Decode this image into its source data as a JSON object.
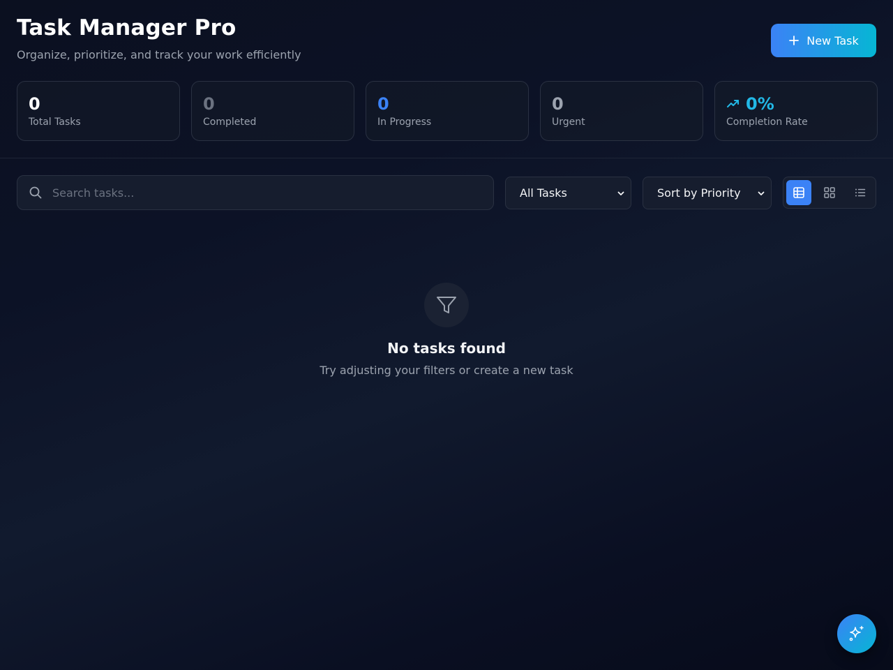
{
  "header": {
    "title": "Task Manager Pro",
    "subtitle": "Organize, prioritize, and track your work efficiently",
    "new_task_label": "New Task"
  },
  "stats": [
    {
      "value": "0",
      "label": "Total Tasks",
      "color": "#ffffff"
    },
    {
      "value": "0",
      "label": "Completed",
      "color": "#6b7280"
    },
    {
      "value": "0",
      "label": "In Progress",
      "color": "#3b82f6"
    },
    {
      "value": "0",
      "label": "Urgent",
      "color": "#9ca3af"
    },
    {
      "value": "0%",
      "label": "Completion Rate",
      "color": "#22b8e6"
    }
  ],
  "toolbar": {
    "search_placeholder": "Search tasks...",
    "filter_selected": "All Tasks",
    "sort_selected": "Sort by Priority",
    "views": [
      "table-view-icon",
      "grid-view-icon",
      "list-view-icon"
    ],
    "active_view": "table-view-icon"
  },
  "empty_state": {
    "icon": "filter-icon",
    "title": "No tasks found",
    "subtitle": "Try adjusting your filters or create a new task"
  },
  "fab": {
    "icon": "sparkles-icon"
  },
  "colors": {
    "accent_blue": "#3b82f6",
    "accent_cyan": "#06b6d4",
    "background": "#0c1226",
    "border": "#2a3142"
  }
}
